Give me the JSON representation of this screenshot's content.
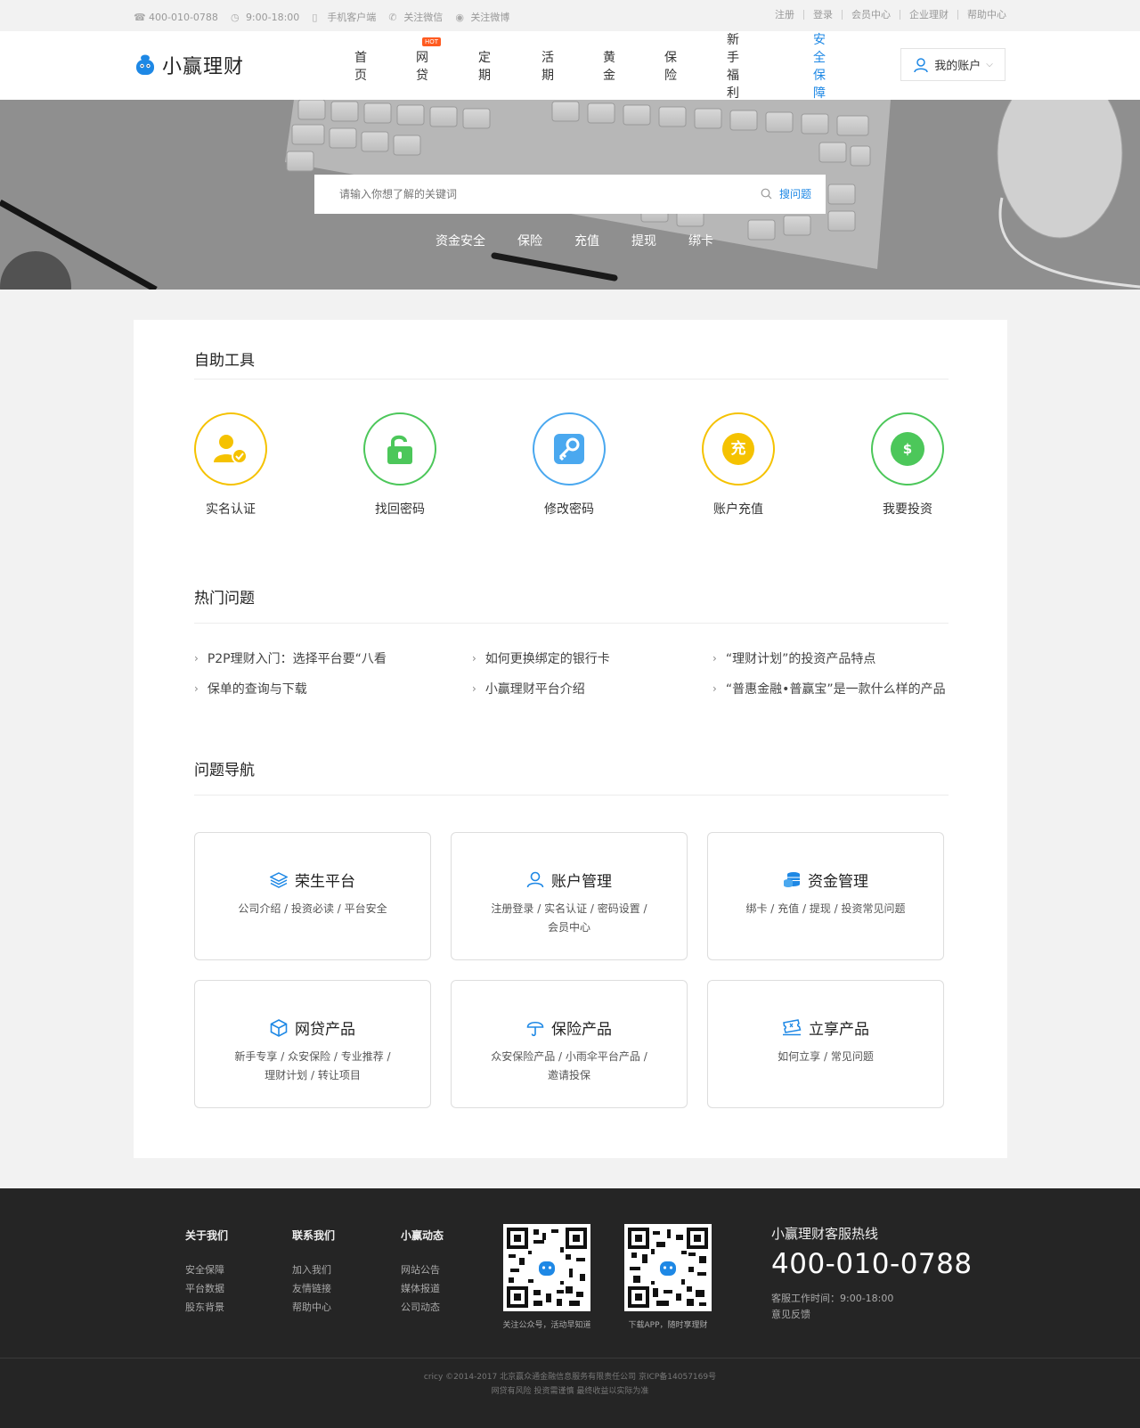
{
  "topbar": {
    "phone": "400-010-0788",
    "hours": "9:00-18:00",
    "mobile_client": "手机客户端",
    "wechat": "关注微信",
    "weibo": "关注微博",
    "links": [
      "注册",
      "登录",
      "会员中心",
      "企业理财",
      "帮助中心"
    ]
  },
  "header": {
    "logo_text": "小赢理财",
    "nav": [
      "首页",
      "网贷",
      "定期",
      "活期",
      "黄金",
      "保险",
      "新手福利",
      "安全保障"
    ],
    "hot_badge": "HOT",
    "active_nav": "安全保障",
    "account_label": "我的账户",
    "accent_color": "#1e88e5"
  },
  "banner": {
    "search_placeholder": "请输入你想了解的关键词",
    "search_button": "搜问题",
    "tags": [
      "资金安全",
      "保险",
      "充值",
      "提现",
      "绑卡"
    ]
  },
  "tools": {
    "title": "自助工具",
    "items": [
      {
        "label": "实名认证",
        "icon": "user-check-icon",
        "color": "#f5c200"
      },
      {
        "label": "找回密码",
        "icon": "unlock-icon",
        "color": "#4cc75a"
      },
      {
        "label": "修改密码",
        "icon": "key-icon",
        "color": "#4aa8ef"
      },
      {
        "label": "账户充值",
        "icon": "recharge-icon",
        "color": "#f5c200",
        "glyph": "充"
      },
      {
        "label": "我要投资",
        "icon": "money-bag-icon",
        "color": "#4cc75a",
        "glyph": "$"
      }
    ]
  },
  "faq": {
    "title": "热门问题",
    "items": [
      "P2P理财入门：选择平台要“八看",
      "如何更换绑定的银行卡",
      "“理财计划”的投资产品特点",
      "保单的查询与下载",
      "小赢理财平台介绍",
      "“普惠金融•普赢宝”是一款什么样的产品"
    ]
  },
  "question_nav": {
    "title": "问题导航",
    "cards": [
      {
        "title": "荣生平台",
        "desc": "公司介绍 / 投资必读 / 平台安全",
        "icon": "layers-icon"
      },
      {
        "title": "账户管理",
        "desc": "注册登录 / 实名认证 / 密码设置 / 会员中心",
        "icon": "user-icon"
      },
      {
        "title": "资金管理",
        "desc": "绑卡 / 充值 / 提现 / 投资常见问题",
        "icon": "coins-icon"
      },
      {
        "title": "网贷产品",
        "desc": "新手专享 / 众安保险 / 专业推荐 / 理财计划 / 转让项目",
        "icon": "box-icon"
      },
      {
        "title": "保险产品",
        "desc": "众安保险产品 / 小雨伞平台产品 / 邀请投保",
        "icon": "umbrella-icon"
      },
      {
        "title": "立享产品",
        "desc": "如何立享 / 常见问题",
        "icon": "ticket-icon"
      }
    ]
  },
  "footer": {
    "cols": [
      {
        "title": "关于我们",
        "links": [
          "安全保障",
          "平台数据",
          "股东背景"
        ]
      },
      {
        "title": "联系我们",
        "links": [
          "加入我们",
          "友情链接",
          "帮助中心"
        ]
      },
      {
        "title": "小赢动态",
        "links": [
          "网站公告",
          "媒体报道",
          "公司动态"
        ]
      }
    ],
    "qr1_caption": "关注公众号，活动早知道",
    "qr2_caption": "下载APP，随时享理财",
    "hotline_title": "小赢理财客服热线",
    "hotline_number": "400-010-0788",
    "service_hours": "客服工作时间：9:00-18:00",
    "feedback": "意见反馈",
    "copyright_line1": "cricy ©2014-2017 北京赢众通金融信息服务有限责任公司 京ICP备14057169号",
    "copyright_line2": "网贷有风险 投资需谨慎 最终收益以实际为准"
  }
}
